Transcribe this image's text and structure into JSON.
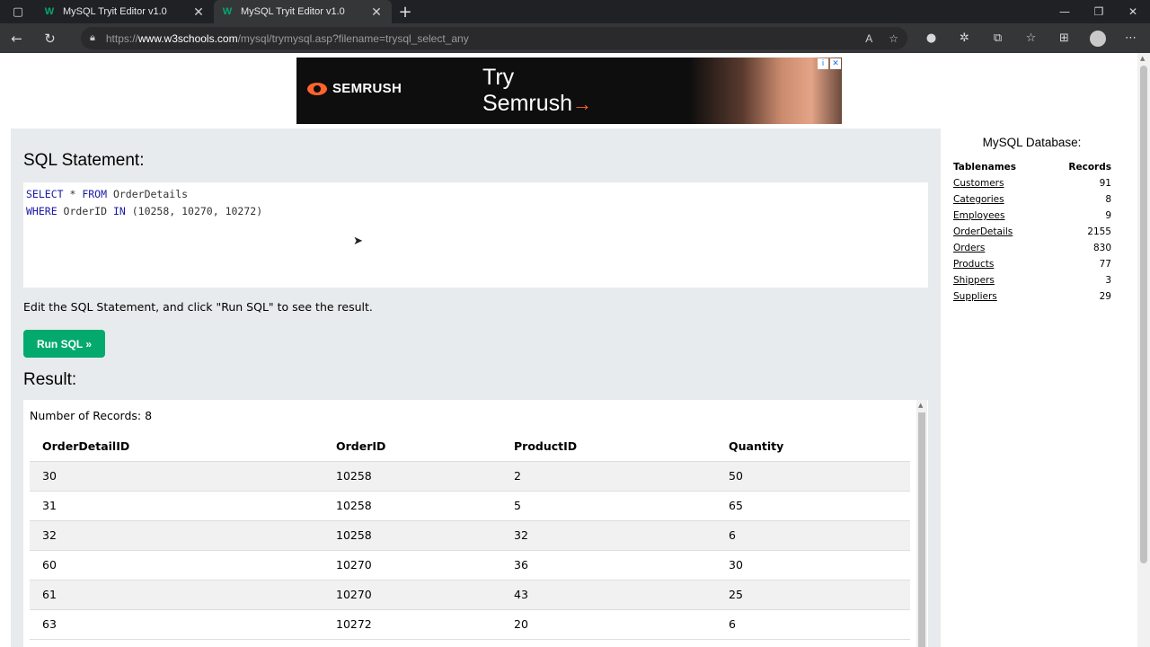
{
  "browser": {
    "tabs": [
      {
        "title": "MySQL Tryit Editor v1.0",
        "favicon": "W"
      },
      {
        "title": "MySQL Tryit Editor v1.0",
        "favicon": "W"
      }
    ],
    "close_glyph": "✕",
    "new_tab_glyph": "+",
    "url": {
      "scheme": "https://",
      "host": "www.w3schools.com",
      "path": "/mysql/trymysql.asp?filename=trysql_select_any"
    }
  },
  "ad": {
    "brand": "SEMRUSH",
    "headline_line1": "Try",
    "headline_line2": "Semrush",
    "arrow": "→",
    "info_glyph": "i",
    "close_glyph": "✕"
  },
  "editor": {
    "heading": "SQL Statement:",
    "code": {
      "line1_kw1": "SELECT",
      "line1_rest1": " * ",
      "line1_kw2": "FROM",
      "line1_rest2": " OrderDetails",
      "line2_kw1": "WHERE",
      "line2_rest1": " OrderID ",
      "line2_kw2": "IN",
      "line2_rest2": " (10258, 10270, 10272)"
    },
    "hint": "Edit the SQL Statement, and click \"Run SQL\" to see the result.",
    "run_button": "Run SQL »"
  },
  "result": {
    "heading": "Result:",
    "records_label": "Number of Records: 8",
    "columns": [
      "OrderDetailID",
      "OrderID",
      "ProductID",
      "Quantity"
    ],
    "rows": [
      [
        "30",
        "10258",
        "2",
        "50"
      ],
      [
        "31",
        "10258",
        "5",
        "65"
      ],
      [
        "32",
        "10258",
        "32",
        "6"
      ],
      [
        "60",
        "10270",
        "36",
        "30"
      ],
      [
        "61",
        "10270",
        "43",
        "25"
      ],
      [
        "63",
        "10272",
        "20",
        "6"
      ]
    ]
  },
  "database": {
    "title": "MySQL Database:",
    "col_tablenames": "Tablenames",
    "col_records": "Records",
    "tables": [
      {
        "name": "Customers",
        "records": "91"
      },
      {
        "name": "Categories",
        "records": "8"
      },
      {
        "name": "Employees",
        "records": "9"
      },
      {
        "name": "OrderDetails",
        "records": "2155"
      },
      {
        "name": "Orders",
        "records": "830"
      },
      {
        "name": "Products",
        "records": "77"
      },
      {
        "name": "Shippers",
        "records": "3"
      },
      {
        "name": "Suppliers",
        "records": "29"
      }
    ]
  },
  "colors": {
    "accent_green": "#04aa6d",
    "semrush_orange": "#ff642d",
    "sql_keyword": "#1a1aa6"
  }
}
